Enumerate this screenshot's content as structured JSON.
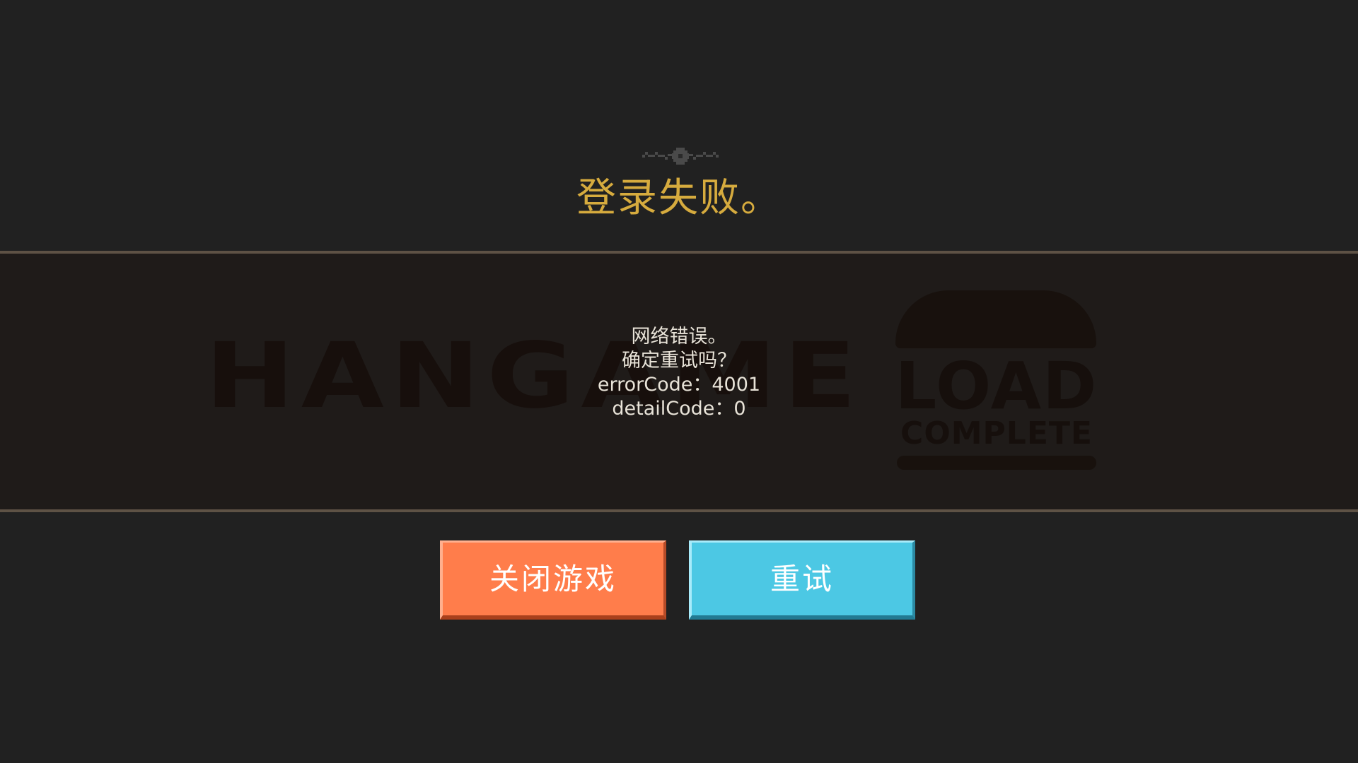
{
  "dialog": {
    "title": "登录失败。",
    "message_lines": [
      "网络错误。",
      "确定重试吗？",
      "errorCode：4001",
      "detailCode：0"
    ]
  },
  "background": {
    "logo_left": "HANGAME",
    "logo_right_top": "LOAD",
    "logo_right_bottom": "COMPLETE"
  },
  "buttons": {
    "close_label": "关闭游戏",
    "retry_label": "重试"
  },
  "colors": {
    "background": "#212121",
    "title": "#d6ab3e",
    "close_button": "#ff7d4b",
    "retry_button": "#4cc8e4",
    "divider": "#5e5245"
  },
  "icons": {
    "ornament": "pixel-flourish-ornament"
  }
}
